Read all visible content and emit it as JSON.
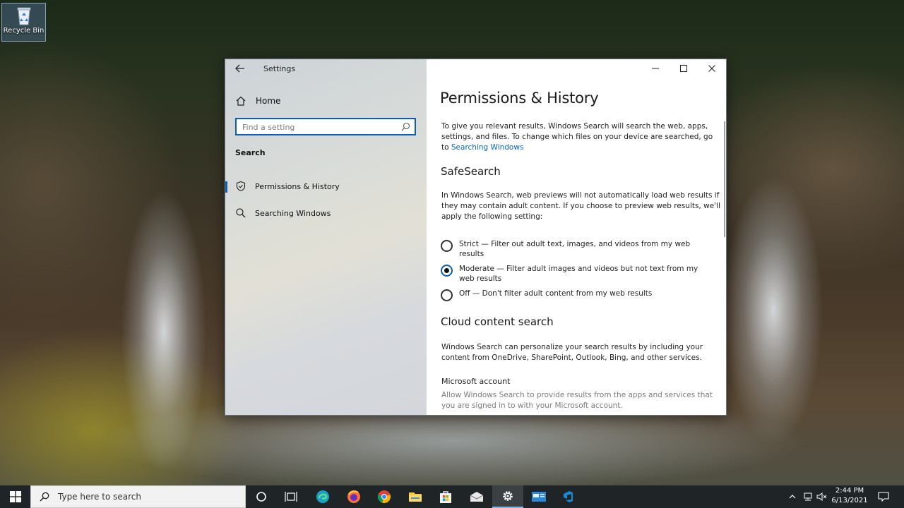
{
  "desktop": {
    "recycle_bin_label": "Recycle Bin"
  },
  "window": {
    "title": "Settings",
    "home_label": "Home",
    "search_placeholder": "Find a setting",
    "section_label": "Search",
    "nav_items": [
      {
        "label": "Permissions & History",
        "icon": "shield-icon",
        "selected": true
      },
      {
        "label": "Searching Windows",
        "icon": "search-icon",
        "selected": false
      }
    ]
  },
  "page": {
    "title": "Permissions & History",
    "intro": "To give you relevant results, Windows Search will search the web, apps, settings, and files. To change which files on your device are searched, go to",
    "intro_link": "Searching Windows",
    "safesearch_heading": "SafeSearch",
    "safesearch_desc": "In Windows Search, web previews will not automatically load web results if they may contain adult content. If you choose to preview web results, we'll apply the following setting:",
    "safesearch_options": [
      {
        "label": "Strict — Filter out adult text, images, and videos from my web results",
        "checked": false
      },
      {
        "label": "Moderate — Filter adult images and videos but not text from my web results",
        "checked": true
      },
      {
        "label": "Off — Don't filter adult content from my web results",
        "checked": false
      }
    ],
    "cloud_heading": "Cloud content search",
    "cloud_desc": "Windows Search can personalize your search results by including your content from OneDrive, SharePoint, Outlook, Bing, and other services.",
    "ms_account_label": "Microsoft account",
    "ms_account_desc": "Allow Windows Search to provide results from the apps and services that you are signed in to with your Microsoft account."
  },
  "taskbar": {
    "search_placeholder": "Type here to search",
    "time": "2:44 PM",
    "date": "6/13/2021",
    "apps": [
      "task-view-icon",
      "edge-icon",
      "firefox-icon",
      "chrome-icon",
      "file-explorer-icon",
      "store-icon",
      "mail-icon",
      "settings-icon",
      "app-icon",
      "azure-devops-icon"
    ]
  },
  "colors": {
    "accent": "#0a5fb0",
    "link": "#0a67b8",
    "taskbar": "#1f2426"
  }
}
